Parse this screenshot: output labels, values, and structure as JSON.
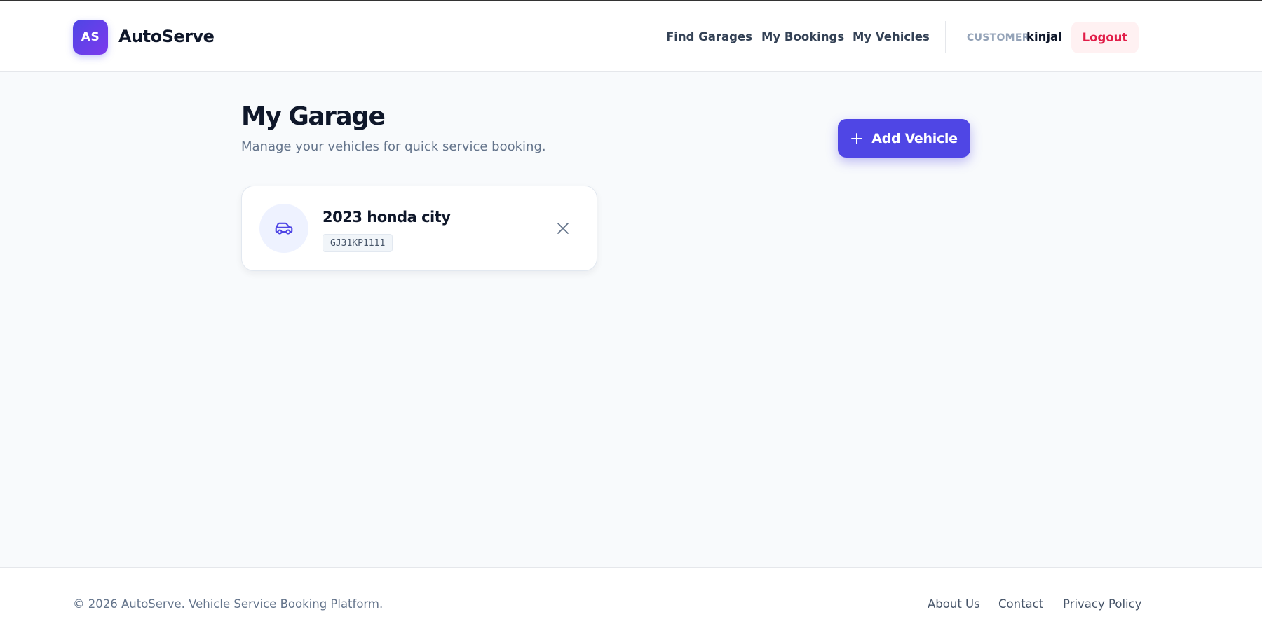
{
  "brand": {
    "logo_text": "AS",
    "name": "AutoServe"
  },
  "nav": {
    "items": [
      {
        "label": "Find Garages"
      },
      {
        "label": "My Bookings"
      },
      {
        "label": "My Vehicles"
      }
    ],
    "role": "CUSTOMER",
    "username": "kinjal",
    "logout_label": "Logout"
  },
  "main": {
    "title": "My Garage",
    "subtitle": "Manage your vehicles for quick service booking.",
    "add_label": "Add Vehicle",
    "vehicles": [
      {
        "name": "2023 honda city",
        "plate": "GJ31KP1111",
        "icon": "car-icon"
      }
    ]
  },
  "footer": {
    "copyright": "© 2026 AutoServe. Vehicle Service Booking Platform.",
    "links": [
      {
        "label": "About Us"
      },
      {
        "label": "Contact"
      },
      {
        "label": "Privacy Policy"
      }
    ]
  },
  "colors": {
    "accent": "#4f46e5",
    "logout_text": "#e11d48",
    "logout_bg": "#fff1f2",
    "background": "#f8fafc"
  }
}
